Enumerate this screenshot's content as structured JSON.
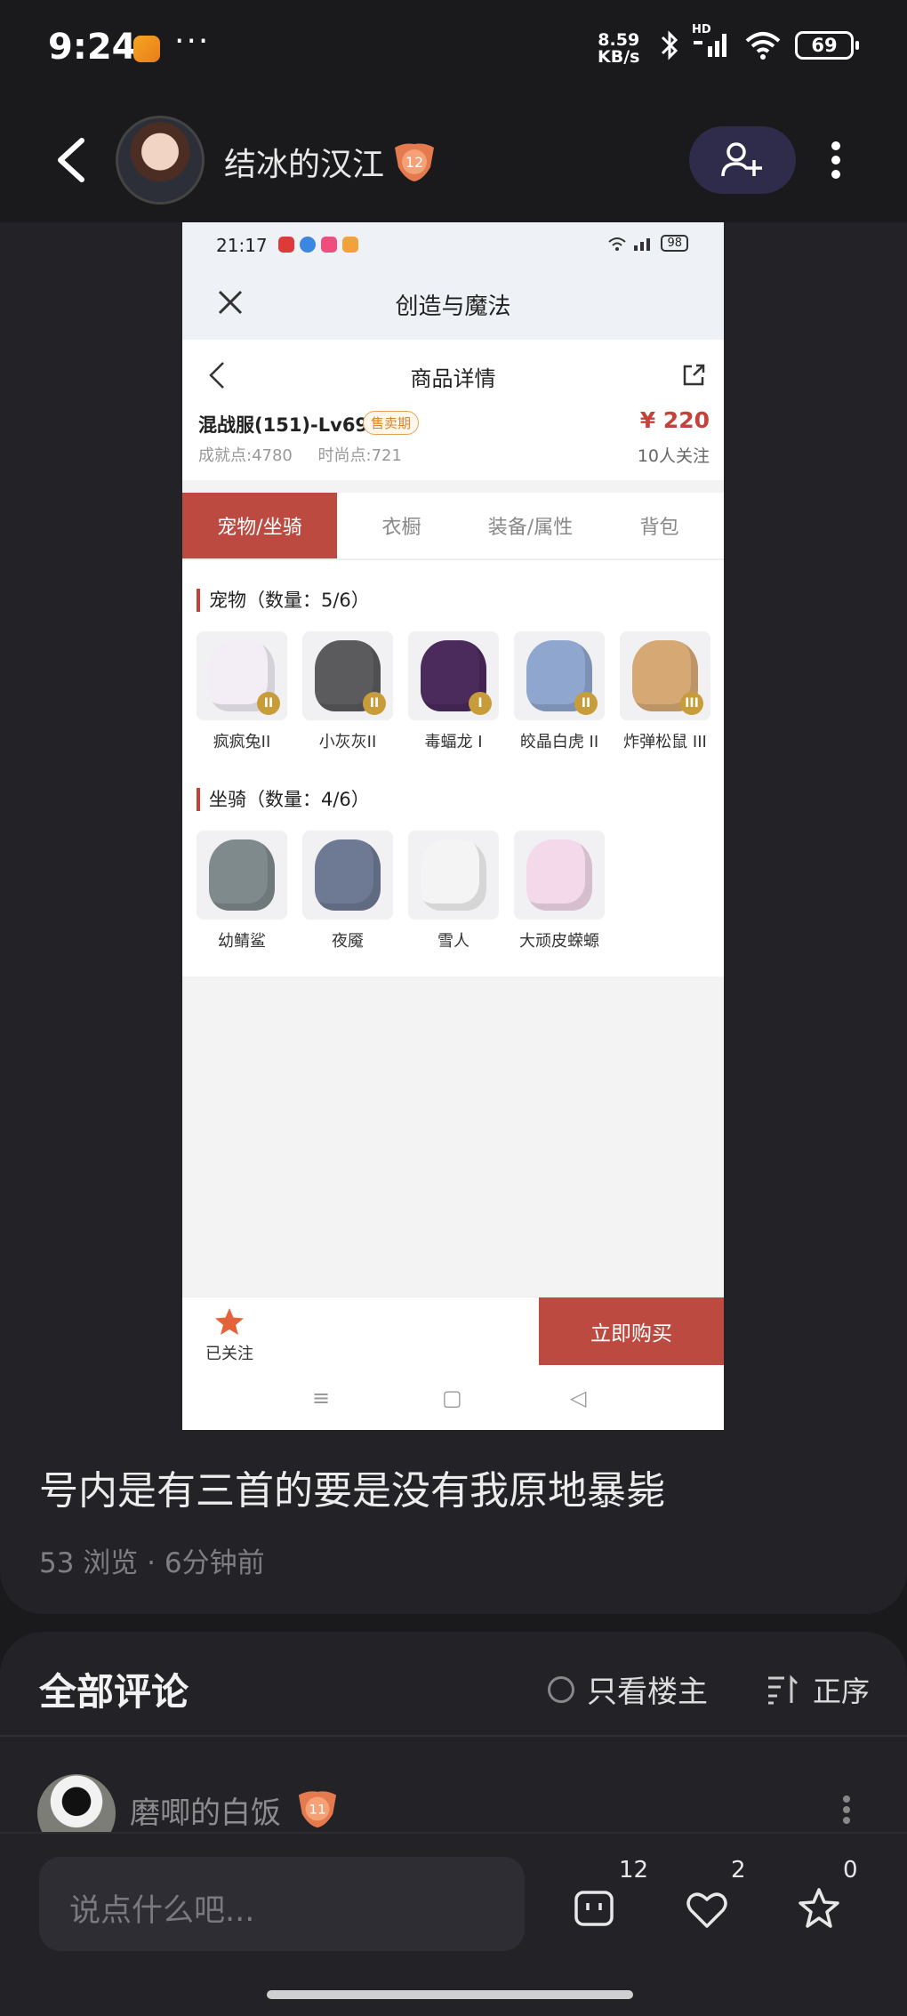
{
  "status_bar": {
    "time": "9:24",
    "dots": "···",
    "net_speed_value": "8.59",
    "net_speed_unit": "KB/s",
    "network": "HD",
    "battery": "69"
  },
  "header": {
    "username": "结冰的汉江",
    "level": "12"
  },
  "screenshot": {
    "status_time": "21:17",
    "battery": "98",
    "app_title": "创造与魔法",
    "detail_title": "商品详情",
    "item_name": "混战服(151)-Lv69",
    "sale_tag": "售卖期",
    "price": "¥ 220",
    "achievement_label": "成就点:",
    "achievement_value": "4780",
    "fashion_label": "时尚点:",
    "fashion_value": "721",
    "followers": "10人关注",
    "tabs": [
      "宠物/坐骑",
      "衣橱",
      "装备/属性",
      "背包"
    ],
    "pets_title": "宠物（数量：5/6）",
    "pets": [
      {
        "name": "疯疯兔II",
        "grade": "II",
        "color": "#f3eef6"
      },
      {
        "name": "小灰灰II",
        "grade": "II",
        "color": "#5b5b5e"
      },
      {
        "name": "毒蝠龙 I",
        "grade": "I",
        "color": "#4a2b5c"
      },
      {
        "name": "皎晶白虎 II",
        "grade": "II",
        "color": "#8fa6cf"
      },
      {
        "name": "炸弹松鼠 III",
        "grade": "III",
        "color": "#d6a974"
      }
    ],
    "mounts_title": "坐骑（数量：4/6）",
    "mounts": [
      {
        "name": "幼鲭鲨",
        "color": "#7f8a8c"
      },
      {
        "name": "夜魇",
        "color": "#6e7a94"
      },
      {
        "name": "雪人",
        "color": "#f4f4f4"
      },
      {
        "name": "大顽皮蝾螈",
        "color": "#f3d9ea"
      }
    ],
    "followed_label": "已关注",
    "buy_label": "立即购买",
    "nav_icons": [
      "≡",
      "▢",
      "◁"
    ]
  },
  "post": {
    "text": "号内是有三首的要是没有我原地暴毙",
    "meta": "53 浏览 · 6分钟前"
  },
  "comments": {
    "title": "全部评论",
    "only_op": "只看楼主",
    "sort": "正序",
    "first": {
      "name": "磨唧的白饭",
      "level": "11"
    }
  },
  "input_bar": {
    "placeholder": "说点什么吧...",
    "comment_count": "12",
    "like_count": "2",
    "star_count": "0"
  }
}
